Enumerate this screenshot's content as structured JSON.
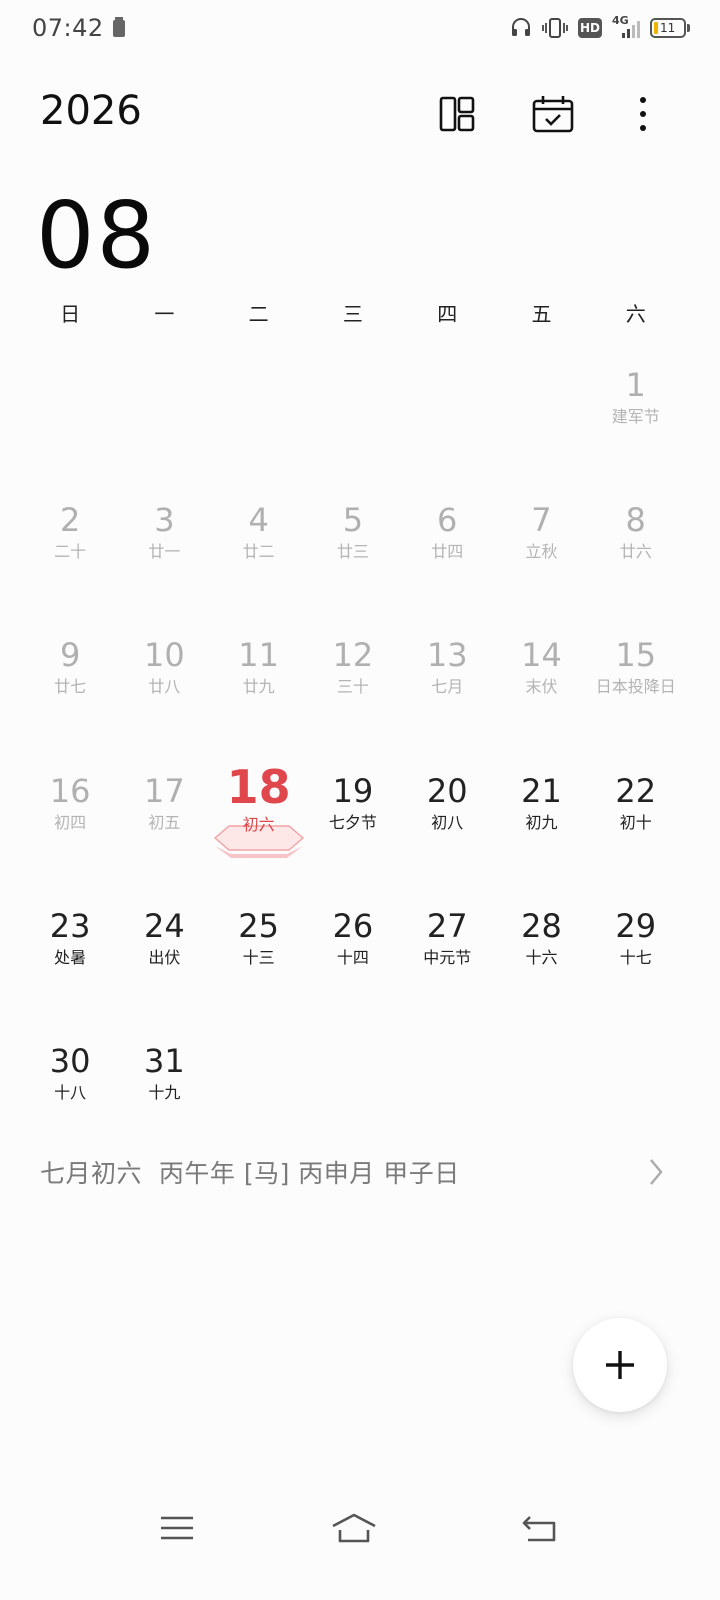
{
  "status_bar": {
    "time": "07:42",
    "network": "4G",
    "hd": "HD",
    "battery_level": "11"
  },
  "header": {
    "year": "2026",
    "month": "08",
    "icons": [
      "layout-icon",
      "calendar-today-icon",
      "more-vertical-icon"
    ]
  },
  "weekdays": [
    "日",
    "一",
    "二",
    "三",
    "四",
    "五",
    "六"
  ],
  "days": [
    {
      "day": "1",
      "lunar": "建军节",
      "state": "past"
    },
    {
      "day": "2",
      "lunar": "二十",
      "state": "past"
    },
    {
      "day": "3",
      "lunar": "廿一",
      "state": "past"
    },
    {
      "day": "4",
      "lunar": "廿二",
      "state": "past"
    },
    {
      "day": "5",
      "lunar": "廿三",
      "state": "past"
    },
    {
      "day": "6",
      "lunar": "廿四",
      "state": "past"
    },
    {
      "day": "7",
      "lunar": "立秋",
      "state": "past"
    },
    {
      "day": "8",
      "lunar": "廿六",
      "state": "past"
    },
    {
      "day": "9",
      "lunar": "廿七",
      "state": "past"
    },
    {
      "day": "10",
      "lunar": "廿八",
      "state": "past"
    },
    {
      "day": "11",
      "lunar": "廿九",
      "state": "past"
    },
    {
      "day": "12",
      "lunar": "三十",
      "state": "past"
    },
    {
      "day": "13",
      "lunar": "七月",
      "state": "past"
    },
    {
      "day": "14",
      "lunar": "末伏",
      "state": "past"
    },
    {
      "day": "15",
      "lunar": "日本投降日",
      "state": "past"
    },
    {
      "day": "16",
      "lunar": "初四",
      "state": "past"
    },
    {
      "day": "17",
      "lunar": "初五",
      "state": "past"
    },
    {
      "day": "18",
      "lunar": "初六",
      "state": "today"
    },
    {
      "day": "19",
      "lunar": "七夕节",
      "state": "future"
    },
    {
      "day": "20",
      "lunar": "初八",
      "state": "future"
    },
    {
      "day": "21",
      "lunar": "初九",
      "state": "future"
    },
    {
      "day": "22",
      "lunar": "初十",
      "state": "future"
    },
    {
      "day": "23",
      "lunar": "处暑",
      "state": "future"
    },
    {
      "day": "24",
      "lunar": "出伏",
      "state": "future"
    },
    {
      "day": "25",
      "lunar": "十三",
      "state": "future"
    },
    {
      "day": "26",
      "lunar": "十四",
      "state": "future"
    },
    {
      "day": "27",
      "lunar": "中元节",
      "state": "future"
    },
    {
      "day": "28",
      "lunar": "十六",
      "state": "future"
    },
    {
      "day": "29",
      "lunar": "十七",
      "state": "future"
    },
    {
      "day": "30",
      "lunar": "十八",
      "state": "future"
    },
    {
      "day": "31",
      "lunar": "十九",
      "state": "future"
    }
  ],
  "first_weekday_index": 6,
  "lunar_info": "七月初六  丙午年 [马] 丙申月 甲子日",
  "colors": {
    "today": "#e0474c",
    "past_text": "#b0b0b0",
    "future_text": "#222222"
  },
  "fab": {
    "icon": "plus-icon"
  },
  "nav": [
    "menu-icon",
    "home-icon",
    "back-icon"
  ]
}
